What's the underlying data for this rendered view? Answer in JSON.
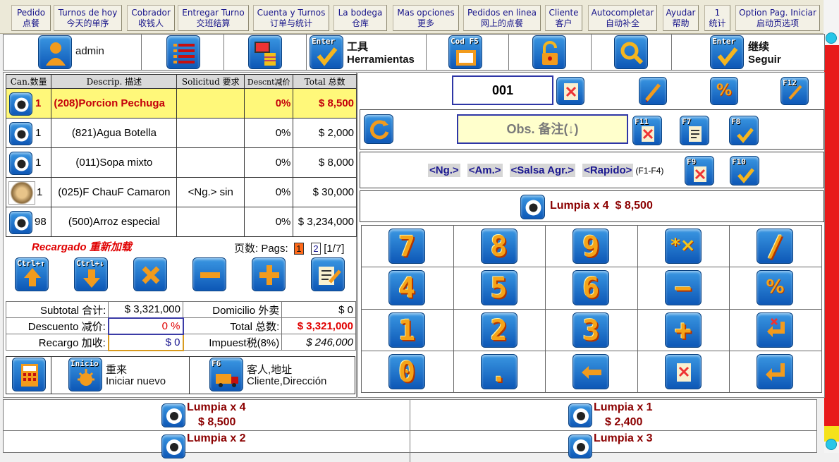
{
  "menu": [
    {
      "en": "Pedido",
      "zh": "点餐"
    },
    {
      "en": "Turnos de hoy",
      "zh": "今天的单序"
    },
    {
      "en": "Cobrador",
      "zh": "收钱人"
    },
    {
      "en": "Entregar Turno",
      "zh": "交班结算"
    },
    {
      "en": "Cuenta y Turnos",
      "zh": "订单与统计"
    },
    {
      "en": "La bodega",
      "zh": "仓库"
    },
    {
      "en": "Mas opciones",
      "zh": "更多"
    },
    {
      "en": "Pedidos en linea",
      "zh": "网上的点餐"
    },
    {
      "en": "Cliente",
      "zh": "客户"
    },
    {
      "en": "Autocompletar",
      "zh": "自动补全"
    },
    {
      "en": "Ayudar",
      "zh": "帮助"
    },
    {
      "en": "1",
      "zh": "统计"
    },
    {
      "en": "Option Pag. Iniciar",
      "zh": "启动页选项"
    }
  ],
  "toolbar": {
    "user": "admin",
    "tools_zh": "工具",
    "tools_es": "Herramientas",
    "tools_key": "Enter",
    "cod_key": "Cod F5",
    "seguir_zh": "继续",
    "seguir_es": "Seguir",
    "seguir_key": "Enter"
  },
  "order": {
    "headers": [
      "Can.数量",
      "Descrip. 描述",
      "Solicitud 要求",
      "Descnt减价",
      "Total 总数"
    ],
    "rows": [
      {
        "qty": "1",
        "desc": "(208)Porcion Pechuga",
        "req": "",
        "disc": "0%",
        "total": "$ 8,500"
      },
      {
        "qty": "1",
        "desc": "(821)Agua Botella",
        "req": "",
        "disc": "0%",
        "total": "$ 2,000"
      },
      {
        "qty": "1",
        "desc": "(011)Sopa mixto",
        "req": "",
        "disc": "0%",
        "total": "$ 8,000"
      },
      {
        "qty": "1",
        "desc": "(025)F ChauF Camaron",
        "req": "<Ng.> sin",
        "disc": "0%",
        "total": "$ 30,000"
      },
      {
        "qty": "98",
        "desc": "(500)Arroz especial",
        "req": "",
        "disc": "0%",
        "total": "$ 3,234,000"
      }
    ],
    "recargado": "Recargado 重新加载",
    "pags_label": "页数: Pags:",
    "page1": "1",
    "page2": "2",
    "page_of": "[1/7]",
    "ctrl_up": "Ctrl+↑",
    "ctrl_down": "Ctrl+↓"
  },
  "totals": {
    "subtotal_label": "Subtotal 合计:",
    "subtotal": "$ 3,321,000",
    "domicilio_label": "Domicilio 外卖",
    "domicilio": "$ 0",
    "descuento_label": "Descuento 减价:",
    "descuento": "0 %",
    "total_label": "Total 总数:",
    "total": "$ 3,321,000",
    "recargo_label": "Recargo 加收:",
    "recargo": "$ 0",
    "impuest_label": "Impuest税(8%)",
    "impuest": "$ 246,000"
  },
  "bottom": {
    "inicio_key": "Inicio",
    "reinicio_zh": "重来",
    "reinicio_es": "Iniciar nuevo",
    "cliente_key": "F6",
    "cliente_zh": "客人,地址",
    "cliente_es": "Cliente,Dirección"
  },
  "right": {
    "num": "001",
    "obs": "Obs. 备注(↓)",
    "tags": [
      "<Ng.>",
      "<Am.>",
      "<Salsa Agr.>",
      "<Rapido>"
    ],
    "tags_hint": "(F1-F4)",
    "fkeys": [
      "F11",
      "F7",
      "F8",
      "F9",
      "F10",
      "F12"
    ],
    "current_item": "Lumpia x 4  $ 8,500"
  },
  "keypad": [
    "7",
    "8",
    "9",
    "*×",
    "/",
    "4",
    "5",
    "6",
    "−",
    "%",
    "1",
    "2",
    "3",
    "+",
    "↵x",
    "0",
    ".",
    "←",
    "del",
    "↵"
  ],
  "tiles": [
    {
      "name": "Lumpia x 4",
      "price": "$ 8,500"
    },
    {
      "name": "Lumpia x 1",
      "price": "$ 2,400"
    },
    {
      "name": "Lumpia x 2",
      "price": ""
    },
    {
      "name": "Lumpia x 3",
      "price": ""
    }
  ],
  "colors": {
    "accent_blue": "#0d57b6",
    "red": "#e00000",
    "selected_row": "#fff87a",
    "scroll_track": "#e81a1a"
  }
}
